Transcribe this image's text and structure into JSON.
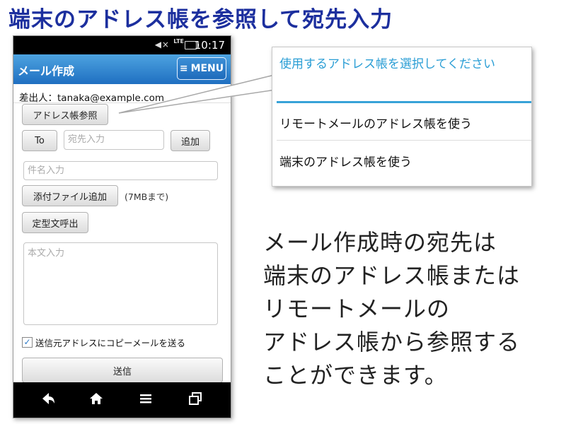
{
  "headline": "端末のアドレス帳を参照して宛先入力",
  "status_bar": {
    "lte": "LTE",
    "time": "10:17"
  },
  "app_bar": {
    "title": "メール作成",
    "menu_label": "MENU"
  },
  "sender_line": "差出人：tanaka@example.com",
  "buttons": {
    "address_book": "アドレス帳参照",
    "to": "To",
    "add": "追加",
    "attach": "添付ファイル追加",
    "template": "定型文呼出",
    "send": "送信"
  },
  "inputs": {
    "recipient_placeholder": "宛先入力",
    "subject_placeholder": "件名入力",
    "body_placeholder": "本文入力"
  },
  "attach_note": "(7MBまで)",
  "copy_checkbox": {
    "label": "送信元アドレスにコピーメールを送る",
    "checked": true
  },
  "popup": {
    "title": "使用するアドレス帳を選択してください",
    "options": [
      "リモートメールのアドレス帳を使う",
      "端末のアドレス帳を使う"
    ]
  },
  "description_lines": [
    "メール作成時の宛先は",
    "端末のアドレス帳または",
    "リモートメールの",
    "アドレス帳から参照する",
    "ことができます。"
  ]
}
